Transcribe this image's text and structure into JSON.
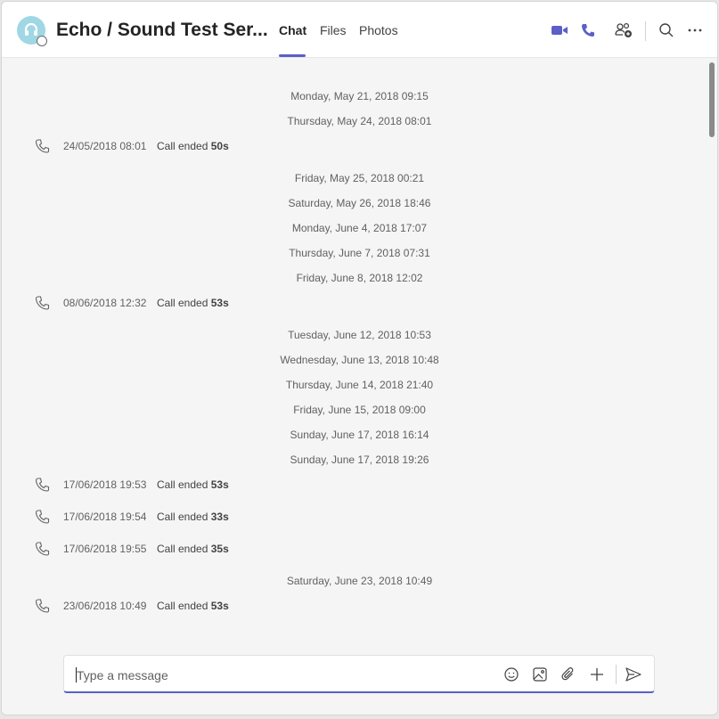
{
  "header": {
    "title": "Echo / Sound Test Ser...",
    "tabs": [
      {
        "label": "Chat",
        "active": true
      },
      {
        "label": "Files",
        "active": false
      },
      {
        "label": "Photos",
        "active": false
      }
    ],
    "actions": [
      "video-call-icon",
      "audio-call-icon",
      "add-people-icon",
      "search-icon",
      "more-options-icon"
    ],
    "accent_color": "#5b5fc7"
  },
  "chat": {
    "dates": [
      "Monday, May 21, 2018 09:15",
      "Thursday, May 24, 2018 08:01",
      "Friday, May 25, 2018 00:21",
      "Saturday, May 26, 2018 18:46",
      "Monday, June 4, 2018 17:07",
      "Thursday, June 7, 2018 07:31",
      "Friday, June 8, 2018 12:02",
      "Tuesday, June 12, 2018 10:53",
      "Wednesday, June 13, 2018 10:48",
      "Thursday, June 14, 2018 21:40",
      "Friday, June 15, 2018 09:00",
      "Sunday, June 17, 2018 16:14",
      "Sunday, June 17, 2018 19:26",
      "Saturday, June 23, 2018 10:49"
    ],
    "calls": [
      {
        "time": "24/05/2018 08:01",
        "text": "Call ended",
        "duration": "50s"
      },
      {
        "time": "08/06/2018 12:32",
        "text": "Call ended",
        "duration": "53s"
      },
      {
        "time": "17/06/2018 19:53",
        "text": "Call ended",
        "duration": "53s"
      },
      {
        "time": "17/06/2018 19:54",
        "text": "Call ended",
        "duration": "33s"
      },
      {
        "time": "17/06/2018 19:55",
        "text": "Call ended",
        "duration": "35s"
      },
      {
        "time": "23/06/2018 10:49",
        "text": "Call ended",
        "duration": "53s"
      }
    ]
  },
  "compose": {
    "placeholder": "Type a message",
    "actions": [
      "emoji-icon",
      "image-icon",
      "attach-icon",
      "add-icon",
      "send-icon"
    ]
  }
}
